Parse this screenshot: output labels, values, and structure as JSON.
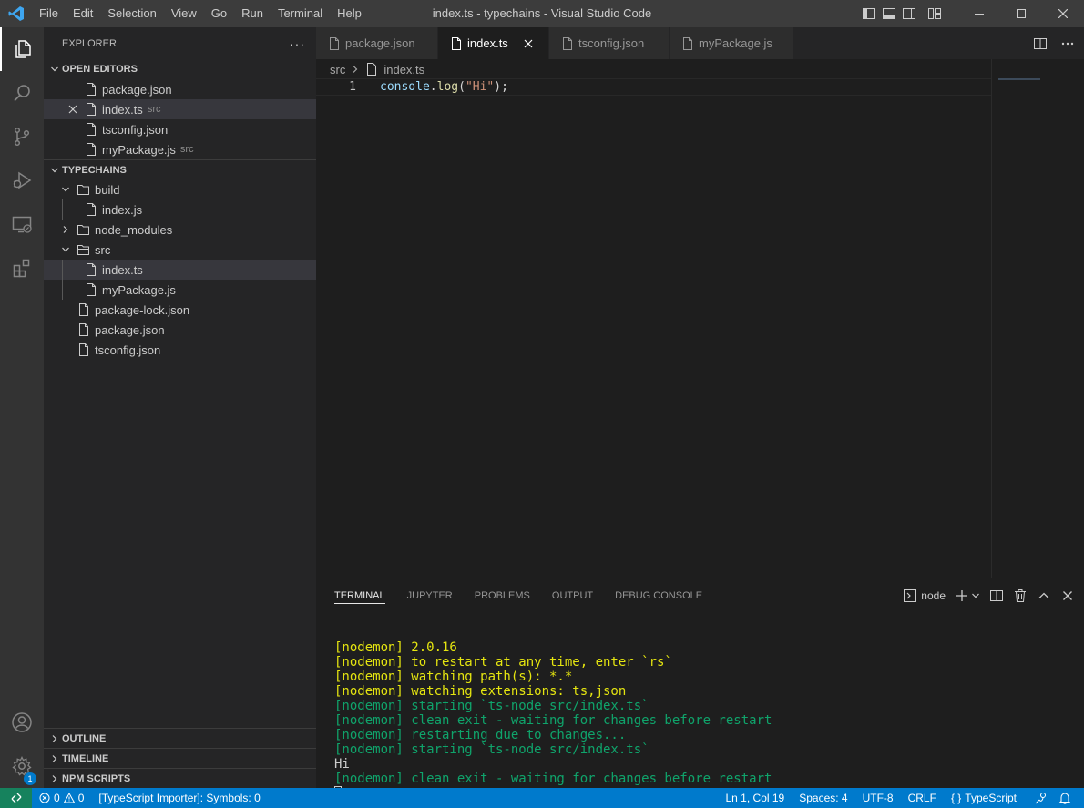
{
  "titlebar": {
    "title": "index.ts - typechains - Visual Studio Code",
    "menu": [
      "File",
      "Edit",
      "Selection",
      "View",
      "Go",
      "Run",
      "Terminal",
      "Help"
    ]
  },
  "activitybar": {
    "icons": [
      "explorer-icon",
      "search-icon",
      "source-control-icon",
      "run-debug-icon",
      "remote-explorer-icon",
      "extensions-icon",
      "account-icon",
      "manage-gear-icon"
    ],
    "manage_badge": "1"
  },
  "sidebar": {
    "title": "EXPLORER",
    "more": "···",
    "open_editors": {
      "label": "OPEN EDITORS",
      "items": [
        {
          "name": "package.json",
          "desc": ""
        },
        {
          "name": "index.ts",
          "desc": "src"
        },
        {
          "name": "tsconfig.json",
          "desc": ""
        },
        {
          "name": "myPackage.js",
          "desc": "src"
        }
      ]
    },
    "workspace": {
      "label": "TYPECHAINS",
      "items": [
        {
          "name": "build"
        },
        {
          "name": "index.js"
        },
        {
          "name": "node_modules"
        },
        {
          "name": "src"
        },
        {
          "name": "index.ts"
        },
        {
          "name": "myPackage.js"
        },
        {
          "name": "package-lock.json"
        },
        {
          "name": "package.json"
        },
        {
          "name": "tsconfig.json"
        }
      ]
    },
    "outline": "OUTLINE",
    "timeline": "TIMELINE",
    "npm_scripts": "NPM SCRIPTS"
  },
  "tabs": [
    {
      "label": "package.json"
    },
    {
      "label": "index.ts"
    },
    {
      "label": "tsconfig.json"
    },
    {
      "label": "myPackage.js"
    }
  ],
  "editor": {
    "breadcrumb": [
      "src",
      "index.ts"
    ],
    "line_number": "1",
    "code": {
      "object": "console",
      "dot": ".",
      "method": "log",
      "open": "(",
      "string": "\"Hi\"",
      "close": ");"
    }
  },
  "panel": {
    "tabs": [
      "TERMINAL",
      "JUPYTER",
      "PROBLEMS",
      "OUTPUT",
      "DEBUG CONSOLE"
    ],
    "shell": "node",
    "terminal_lines": [
      {
        "text": "[nodemon] 2.0.16",
        "color": "yellow"
      },
      {
        "text": "[nodemon] to restart at any time, enter `rs`",
        "color": "yellow"
      },
      {
        "text": "[nodemon] watching path(s): *.*",
        "color": "yellow"
      },
      {
        "text": "[nodemon] watching extensions: ts,json",
        "color": "yellow"
      },
      {
        "text": "[nodemon] starting `ts-node src/index.ts`",
        "color": "green"
      },
      {
        "text": "[nodemon] clean exit - waiting for changes before restart",
        "color": "green"
      },
      {
        "text": "[nodemon] restarting due to changes...",
        "color": "green"
      },
      {
        "text": "[nodemon] starting `ts-node src/index.ts`",
        "color": "green"
      },
      {
        "text": "Hi",
        "color": "white"
      },
      {
        "text": "[nodemon] clean exit - waiting for changes before restart",
        "color": "green"
      }
    ]
  },
  "statusbar": {
    "errors": "0",
    "warnings": "0",
    "importer": "[TypeScript Importer]: Symbols: 0",
    "position": "Ln 1, Col 19",
    "spaces": "Spaces: 4",
    "encoding": "UTF-8",
    "eol": "CRLF",
    "language_icon": "{ }",
    "language": "TypeScript"
  },
  "colors": {
    "accent": "#007acc",
    "remote": "#16825d",
    "terminal_yellow": "#e5e510",
    "terminal_green": "#0dbc79"
  }
}
